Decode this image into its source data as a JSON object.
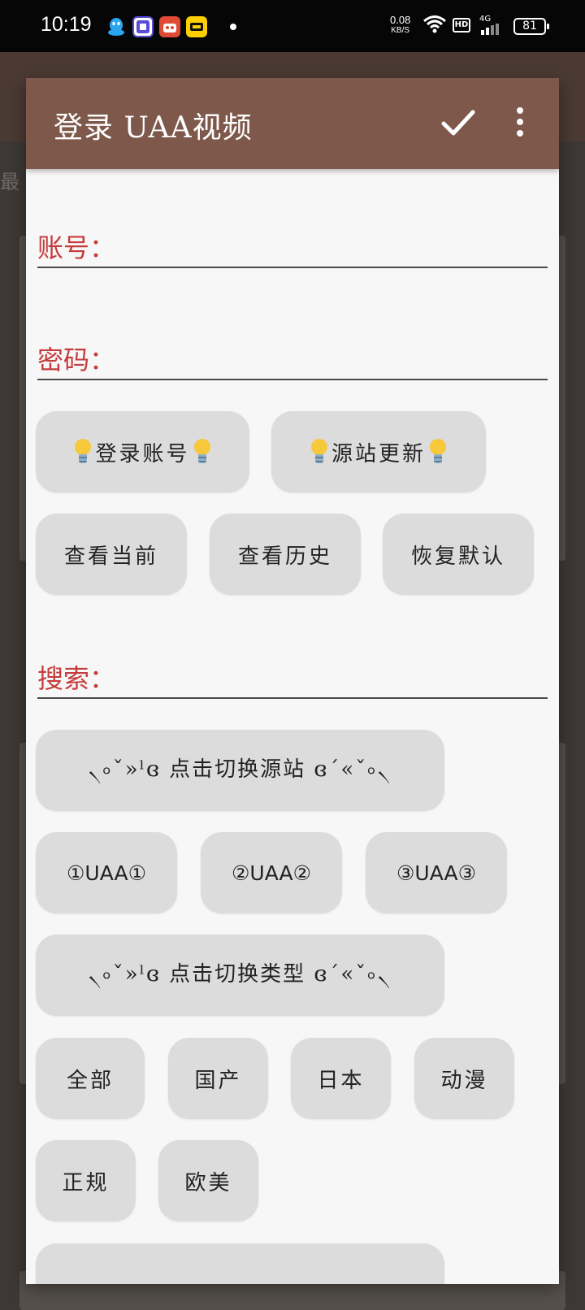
{
  "status_bar": {
    "time": "10:19",
    "net_speed_value": "0.08",
    "net_speed_unit": "KB/S",
    "hd": "HD",
    "network": "4G",
    "battery": "81",
    "apps": [
      "qq-icon",
      "tieba-icon",
      "app-icon",
      "meituan-icon"
    ]
  },
  "dialog": {
    "title": "登录 UAA视频",
    "confirm_icon": "check-icon",
    "menu_icon": "more-vert-icon",
    "account_label": "账号：",
    "password_label": "密码：",
    "buttons_row1": [
      "登录账号",
      "源站更新"
    ],
    "buttons_row2": [
      "查看当前",
      "查看历史",
      "恢复默认"
    ],
    "search_label": "搜索：",
    "switch_source": "৲৹ˇ»ˡɞ 点击切换源站 ɞ´«ˇ৹৲",
    "sources": [
      "①UAA①",
      "②UAA②",
      "③UAA③"
    ],
    "switch_type": "৲৹ˇ»ˡɞ 点击切换类型 ɞ´«ˇ৹৲",
    "types_row1": [
      "全部",
      "国产",
      "日本",
      "动漫"
    ],
    "types_row2": [
      "正规",
      "欧美"
    ]
  },
  "colors": {
    "header": "#7d584b",
    "label_red": "#c63b3b",
    "button_bg": "#dcdcdc",
    "dialog_bg": "#f7f7f7"
  }
}
